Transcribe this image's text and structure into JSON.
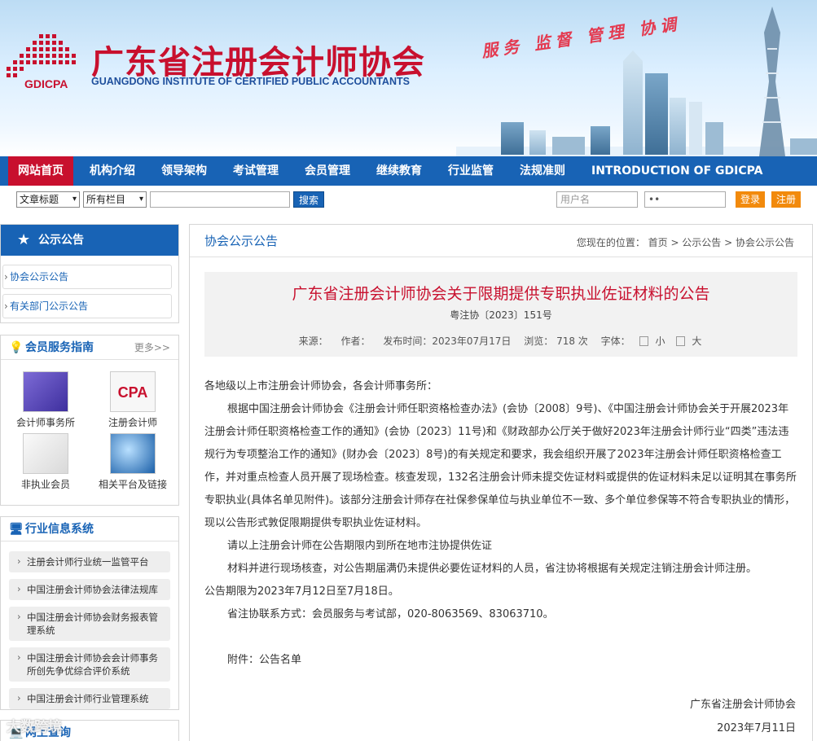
{
  "header": {
    "logo_text": "GDICPA",
    "title": "广东省注册会计师协会",
    "subtitle": "GUANGDONG INSTITUTE OF CERTIFIED PUBLIC ACCOUNTANTS",
    "slogan": "服务 监督 管理 协调"
  },
  "nav": {
    "items": [
      "网站首页",
      "机构介绍",
      "领导架构",
      "考试管理",
      "会员管理",
      "继续教育",
      "行业监管",
      "法规准则",
      "INTRODUCTION OF GDICPA"
    ]
  },
  "toolbar": {
    "select_type": "文章标题",
    "select_column": "所有栏目",
    "search_value": "",
    "search_button": "搜索",
    "username_placeholder": "用户名",
    "password_value": "••",
    "login_button": "登录",
    "register_button": "注册"
  },
  "sidebar": {
    "notice": {
      "title": "公示公告",
      "links": [
        "协会公示公告",
        "有关部门公示公告"
      ]
    },
    "services": {
      "title": "会员服务指南",
      "more": "更多>>",
      "items": [
        "会计师事务所",
        "注册会计师",
        "非执业会员",
        "相关平台及链接"
      ],
      "cpa_icon_text": "CPA"
    },
    "industry": {
      "title": "行业信息系统",
      "items": [
        "注册会计师行业统一监管平台",
        "中国注册会计师协会法律法规库",
        "中国注册会计师协会财务报表管理系统",
        "中国注册会计师协会会计师事务所创先争优综合评价系统",
        "中国注册会计师行业管理系统"
      ]
    },
    "online": {
      "title": "网上查询"
    }
  },
  "main": {
    "section_title": "协会公示公告",
    "breadcrumb": "您现在的位置： 首页 > 公示公告 > 协会公示公告",
    "article": {
      "title": "广东省注册会计师协会关于限期提供专职执业佐证材料的公告",
      "doc_no": "粤注协〔2023〕151号",
      "source": "来源：",
      "author": "作者：",
      "publish_time": "发布时间：2023年07月17日",
      "views": "浏览：  718 次",
      "font_label": "字体：",
      "font_small": "小",
      "font_large": "大",
      "salutation": "各地级以上市注册会计师协会，各会计师事务所：",
      "para1": "根据中国注册会计师协会《注册会计师任职资格检查办法》(会协〔2008〕9号)、《中国注册会计师协会关于开展2023年注册会计师任职资格检查工作的通知》(会协〔2023〕11号)和《财政部办公厅关于做好2023年注册会计师行业“四类”违法违规行为专项整治工作的通知》(财办会〔2023〕8号)的有关规定和要求，我会组织开展了2023年注册会计师任职资格检查工作，并对重点检查人员开展了现场检查。核查发现，132名注册会计师未提交佐证材料或提供的佐证材料未足以证明其在事务所专职执业(具体名单见附件)。该部分注册会计师存在社保参保单位与执业单位不一致、多个单位参保等不符合专职执业的情形，现以公告形式敦促限期提供专职执业佐证材料。",
      "para2": "请以上注册会计师在公告期限内到所在地市注协提供佐证",
      "para3": "材料并进行现场核查，对公告期届满仍未提供必要佐证材料的人员，省注协将根据有关规定注销注册会计师注册。",
      "para4": "公告期限为2023年7月12日至7月18日。",
      "contact": "省注协联系方式：会员服务与考试部，020-8063569、83063710。",
      "attachment": "附件：公告名单",
      "sign_org": "广东省注册会计师协会",
      "sign_date": "2023年7月11日"
    }
  },
  "watermark": "大数跨境",
  "colors": {
    "brand_red": "#c8102e",
    "nav_blue": "#1863b5",
    "button_orange": "#f28a0c"
  }
}
